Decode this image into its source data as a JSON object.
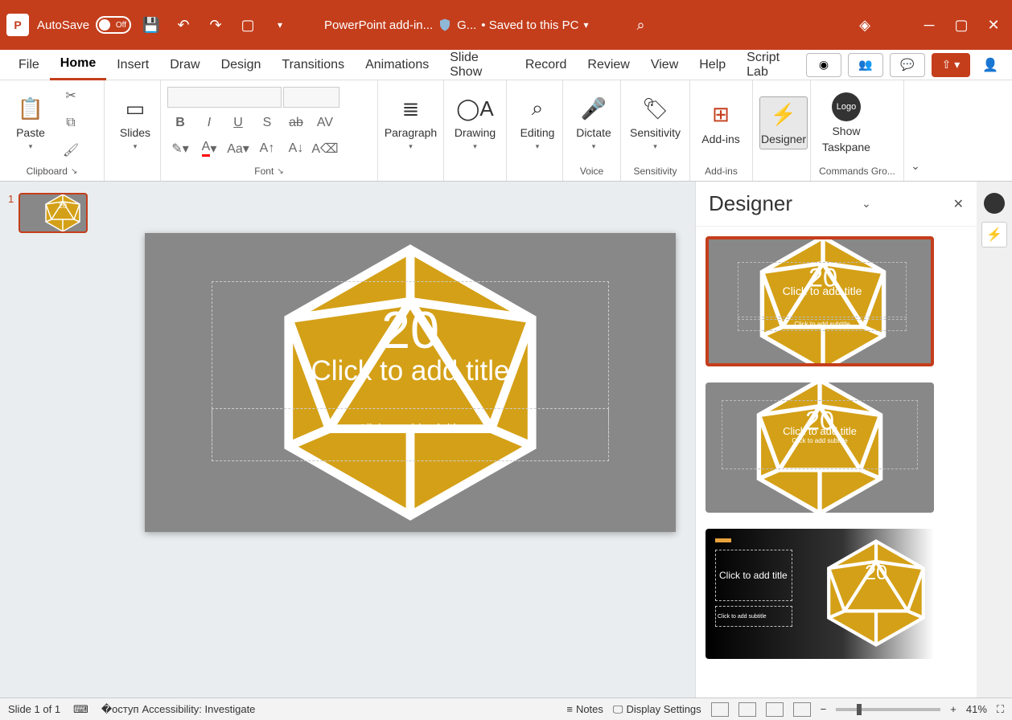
{
  "titlebar": {
    "autosave_label": "AutoSave",
    "autosave_state": "Off",
    "doc_title": "PowerPoint add-in...",
    "guard_label": "G...",
    "save_state": "• Saved to this PC"
  },
  "tabs": [
    "File",
    "Home",
    "Insert",
    "Draw",
    "Design",
    "Transitions",
    "Animations",
    "Slide Show",
    "Record",
    "Review",
    "View",
    "Help",
    "Script Lab"
  ],
  "active_tab": "Home",
  "ribbon": {
    "clipboard": {
      "paste": "Paste",
      "group": "Clipboard"
    },
    "slides": {
      "button": "Slides"
    },
    "font": {
      "group": "Font"
    },
    "paragraph": {
      "button": "Paragraph"
    },
    "drawing": {
      "button": "Drawing"
    },
    "editing": {
      "button": "Editing"
    },
    "voice": {
      "button": "Dictate",
      "group": "Voice"
    },
    "sensitivity": {
      "button": "Sensitivity",
      "group": "Sensitivity"
    },
    "addins": {
      "button": "Add-ins",
      "group": "Add-ins"
    },
    "designer": {
      "button": "Designer"
    },
    "commands": {
      "button_line1": "Show",
      "button_line2": "Taskpane",
      "group": "Commands Gro..."
    }
  },
  "thumbs": {
    "index": "1"
  },
  "slide": {
    "title_placeholder": "Click to add title",
    "subtitle_placeholder": "Click to add subtitle",
    "die_value": "20"
  },
  "designer_panel": {
    "title": "Designer",
    "cards": [
      {
        "title": "Click to add title",
        "subtitle": "Click to add subtitle"
      },
      {
        "title": "Click to add title",
        "subtitle": "Click to add subtitle"
      },
      {
        "title": "Click to add title",
        "subtitle": "Click to add subtitle"
      }
    ]
  },
  "status": {
    "slide_info": "Slide 1 of 1",
    "accessibility": "Accessibility: Investigate",
    "notes": "Notes",
    "display": "Display Settings",
    "zoom_pct": "41%"
  }
}
